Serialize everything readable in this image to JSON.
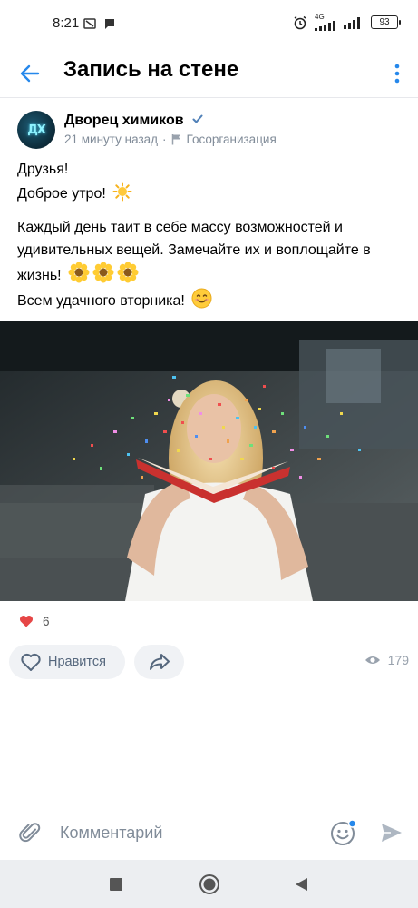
{
  "status_bar": {
    "time": "8:21",
    "network": "4G",
    "battery": "93"
  },
  "header": {
    "title": "Запись на стене"
  },
  "post": {
    "author": "Дворец химиков",
    "avatar_initials": "ДХ",
    "time": "21 минуту назад",
    "category": "Госорганизация",
    "text": {
      "line1": "Друзья!",
      "line2": "Доброе утро!",
      "paragraph": "Каждый день таит в себе массу возможностей и удивительных вещей. Замечайте их и воплощайте в жизнь!",
      "closing": "Всем удачного вторника!"
    },
    "likes_count": "6",
    "views_count": "179"
  },
  "actions": {
    "like_label": "Нравится"
  },
  "comment": {
    "placeholder": "Комментарий"
  },
  "icons": [
    "back-arrow-icon",
    "more-vertical-icon",
    "verified-icon",
    "flag-icon",
    "sun-icon",
    "sunflower-icon",
    "smile-icon",
    "heart-icon",
    "share-icon",
    "eye-icon",
    "paperclip-icon",
    "emoji-icon",
    "send-icon"
  ],
  "colors": {
    "accent": "#2688eb",
    "like_red": "#e64646",
    "secondary_text": "#818c99",
    "button_bg": "#f0f2f5"
  }
}
